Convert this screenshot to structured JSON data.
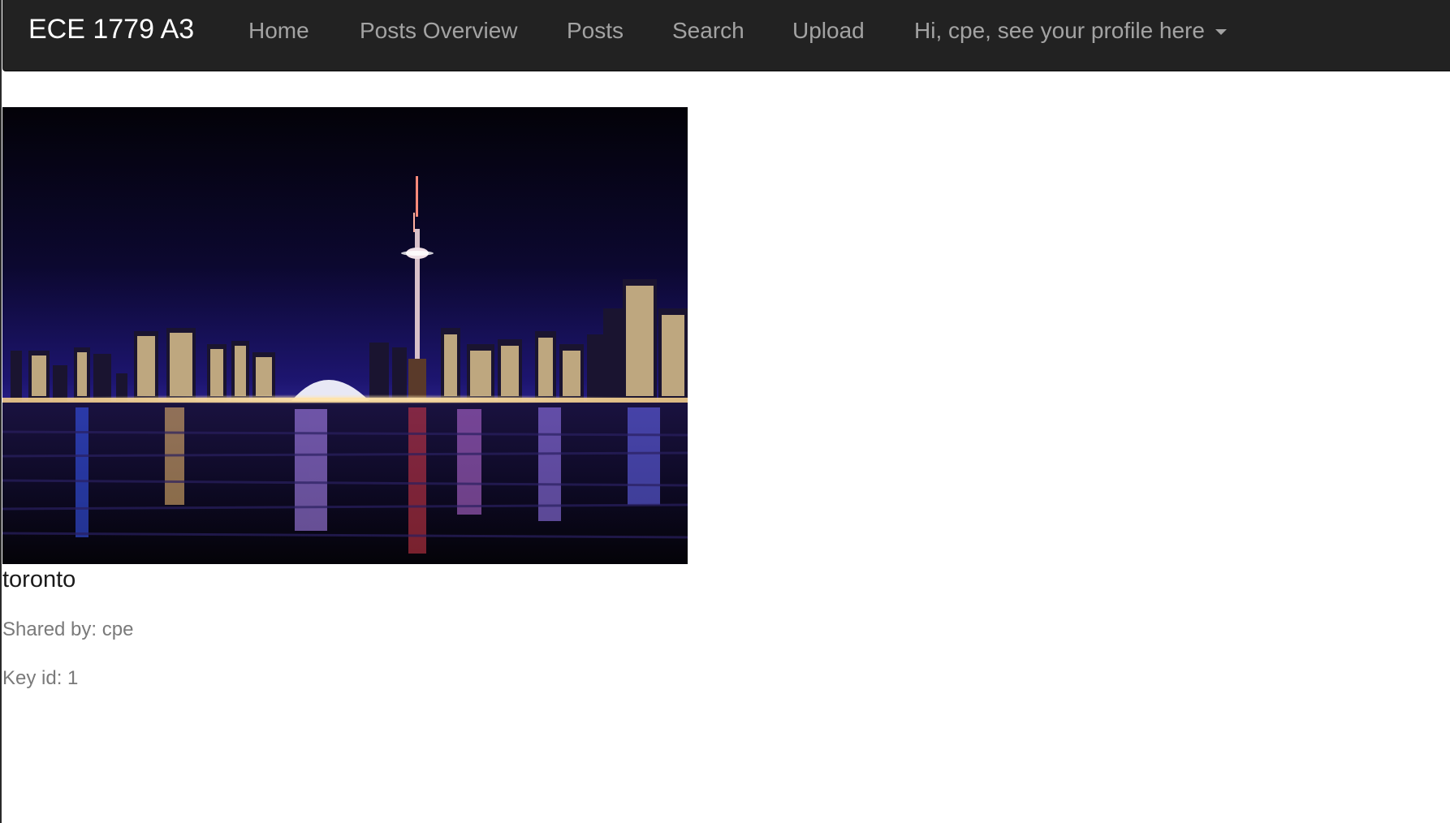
{
  "navbar": {
    "brand": "ECE 1779 A3",
    "links": [
      {
        "label": "Home"
      },
      {
        "label": "Posts Overview"
      },
      {
        "label": "Posts"
      },
      {
        "label": "Search"
      },
      {
        "label": "Upload"
      }
    ],
    "profile_label": "Hi, cpe, see your profile here",
    "profile_icon": "caret-down-icon"
  },
  "post": {
    "image_subject": "toronto-skyline-at-night",
    "title": "toronto",
    "shared_by": "Shared by: cpe",
    "key_id": "Key id: 1"
  },
  "colors": {
    "navbar_bg": "#222222",
    "brand": "#ffffff",
    "nav_link": "#a3a3a3",
    "meta_text": "#7a7a7a"
  }
}
